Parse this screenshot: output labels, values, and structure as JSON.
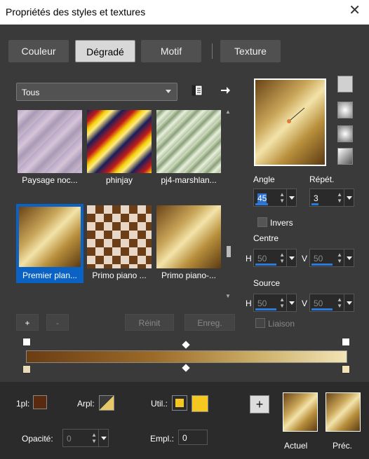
{
  "window": {
    "title": "Propriétés des styles et textures",
    "close": "✕"
  },
  "tabs": [
    {
      "label": "Couleur"
    },
    {
      "label": "Dégradé"
    },
    {
      "label": "Motif"
    },
    {
      "label": "Texture"
    }
  ],
  "library": {
    "dropdown": "Tous",
    "items": [
      {
        "label": "Paysage noc..."
      },
      {
        "label": "phinjay"
      },
      {
        "label": "pj4-marshlan..."
      },
      {
        "label": "Premier plan..."
      },
      {
        "label": "Primo piano ..."
      },
      {
        "label": "Primo piano-..."
      }
    ]
  },
  "buttons": {
    "add": "+",
    "remove": "-",
    "reset": "Réinit",
    "save": "Enreg.",
    "add_color": "+"
  },
  "settings": {
    "angle_label": "Angle",
    "angle_value": "45",
    "repeat_label": "Répét.",
    "repeat_value": "3",
    "invert_label": "Invers",
    "center_label": "Centre",
    "center_h_label": "H",
    "center_h": "50",
    "center_v_label": "V",
    "center_v": "50",
    "source_label": "Source",
    "source_h_label": "H",
    "source_h": "50",
    "source_v_label": "V",
    "source_v": "50",
    "link_label": "Liaison"
  },
  "footer": {
    "fg_label": "1pl:",
    "arpl_label": "Arpl:",
    "util_label": "Util.:",
    "opacity_label": "Opacité:",
    "opacity_value": "0",
    "empl_label": "Empl.:",
    "empl_value": "0",
    "current_label": "Actuel",
    "prev_label": "Préc."
  },
  "colors": {
    "fg": "#5a2a10",
    "accent": "#f4c81e",
    "selection": "#0a62c4"
  }
}
